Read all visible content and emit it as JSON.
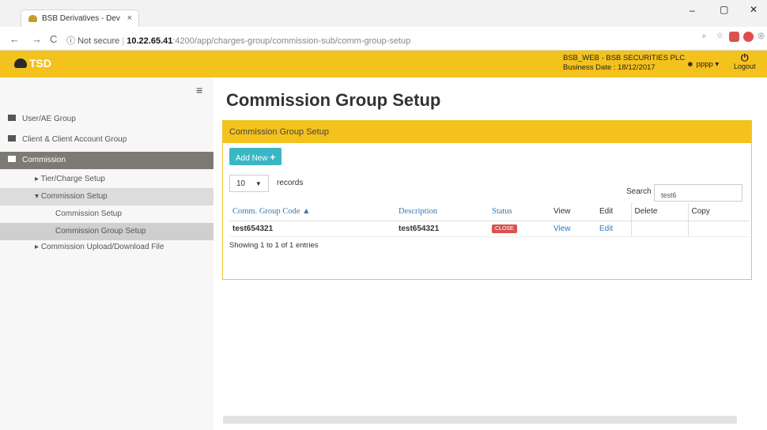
{
  "browser": {
    "tab_title": "BSB Derivatives - Dev",
    "tab_close": "×",
    "security": "Not secure",
    "url_host": "10.22.65.41",
    "url_path": ":4200/app/charges-group/commission-sub/comm-group-setup",
    "back": "←",
    "forward": "→",
    "reload": "C"
  },
  "header": {
    "logo_text": "TSD",
    "company": "BSB_WEB - BSB SECURITIES PLC",
    "business_date": "Business Date : 18/12/2017",
    "user": "pppp",
    "logout": "Logout",
    "accent": "#f4c21c"
  },
  "sidebar": {
    "items": [
      {
        "label": "User/AE Group"
      },
      {
        "label": "Client & Client Account Group"
      },
      {
        "label": "Commission"
      },
      {
        "label": "Tier/Charge Setup"
      },
      {
        "label": "Commission Setup"
      },
      {
        "label": "Commission Setup"
      },
      {
        "label": "Commission Group Setup"
      },
      {
        "label": "Commission Upload/Download File"
      }
    ]
  },
  "main": {
    "page_title": "Commission Group Setup",
    "panel_title": "Commission Group Setup",
    "add_label": "Add New",
    "page_length": "10",
    "records_label": "records",
    "search_label": "Search",
    "search_value": "test6",
    "columns": [
      "Comm. Group Code",
      "Description",
      "Status",
      "View",
      "Edit",
      "Delete",
      "Copy"
    ],
    "rows": [
      {
        "code": "test654321",
        "description": "test654321",
        "status": "CLOSE",
        "view": "View",
        "edit": "Edit",
        "delete": "",
        "copy": ""
      }
    ],
    "info": "Showing 1 to 1 of 1 entries"
  }
}
